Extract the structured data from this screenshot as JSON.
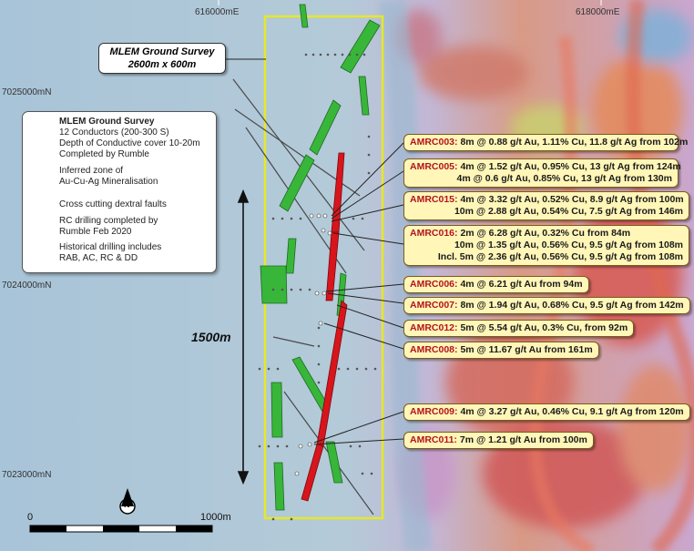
{
  "map": {
    "grid_labels": {
      "e1": "616000mE",
      "e2": "618000mE",
      "n1": "7025000mN",
      "n2": "7024000mN",
      "n3": "7023000mN"
    },
    "survey_box": {
      "line1": "MLEM Ground Survey",
      "line2": "2600m x 600m"
    },
    "legend": {
      "title": "MLEM Ground Survey",
      "conductors": [
        "12 Conductors (200-300 S)",
        "Depth of Conductive cover 10-20m",
        "Completed by Rumble"
      ],
      "mineral": [
        "Inferred zone of",
        "Au-Cu-Ag Mineralisation"
      ],
      "faults": "Cross cutting dextral faults",
      "rc": [
        "RC drilling completed by",
        "Rumble Feb 2020"
      ],
      "historical": [
        "Historical drilling includes",
        "RAB, AC, RC & DD"
      ],
      "conductor_color": "#38b63a",
      "mineral_color": "#d8151c"
    },
    "dimension_label": "1500m",
    "north_label": "N",
    "scale": {
      "start": "0",
      "end": "1000m"
    },
    "callouts": [
      {
        "id": "AMRC003:",
        "lines": [
          "8m @ 0.88 g/t Au, 1.11% Cu, 11.8 g/t Ag from 102m"
        ]
      },
      {
        "id": "AMRC005:",
        "lines": [
          "4m @ 1.52 g/t Au, 0.95% Cu, 13 g/t Ag from 124m",
          "4m @ 0.6 g/t Au, 0.85% Cu, 13 g/t Ag from 130m"
        ]
      },
      {
        "id": "AMRC015:",
        "lines": [
          "4m @ 3.32 g/t Au, 0.52% Cu, 8.9 g/t Ag from 100m",
          "10m @ 2.88 g/t Au, 0.54% Cu, 7.5 g/t Ag from 146m"
        ]
      },
      {
        "id": "AMRC016:",
        "lines": [
          "2m @ 6.28 g/t Au, 0.32% Cu from 84m",
          "10m @ 1.35 g/t Au, 0.56% Cu, 9.5 g/t Ag from 108m",
          "Incl. 5m @ 2.36 g/t Au, 0.56% Cu, 9.5 g/t Ag from 108m"
        ]
      },
      {
        "id": "AMRC006:",
        "lines": [
          "4m @ 6.21 g/t Au from 94m"
        ]
      },
      {
        "id": "AMRC007:",
        "lines": [
          "8m @ 1.94 g/t Au, 0.68% Cu, 9.5 g/t Ag from 142m"
        ]
      },
      {
        "id": "AMRC012:",
        "lines": [
          "5m @ 5.54 g/t Au, 0.3% Cu, from 92m"
        ]
      },
      {
        "id": "AMRC008:",
        "lines": [
          "5m @ 11.67 g/t Au from 161m"
        ]
      },
      {
        "id": "AMRC009:",
        "lines": [
          "4m @ 3.27 g/t Au, 0.46% Cu, 9.1 g/t Ag from 120m"
        ]
      },
      {
        "id": "AMRC011:",
        "lines": [
          "7m @ 1.21 g/t Au from 100m"
        ]
      }
    ]
  }
}
